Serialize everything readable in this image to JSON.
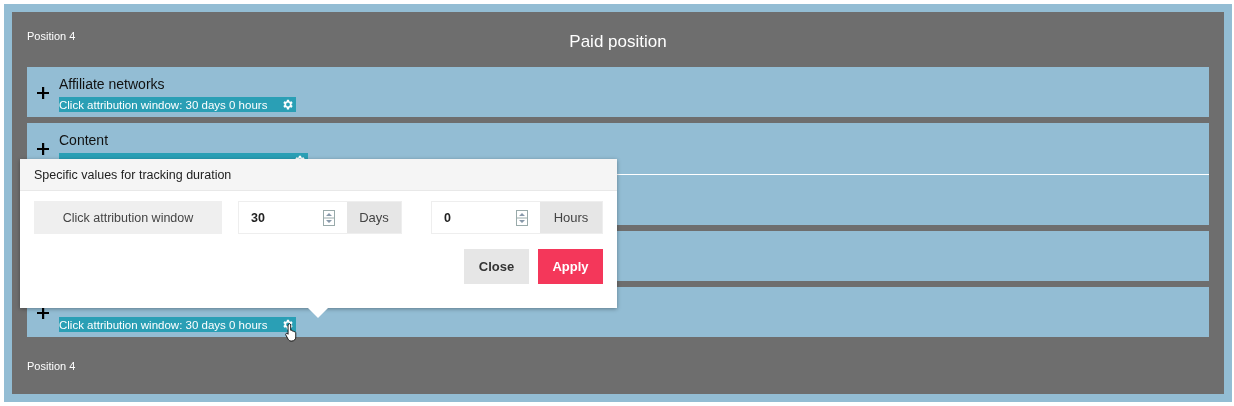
{
  "panel": {
    "label_top": "Position 4",
    "title": "Paid position",
    "label_bottom": "Position 4"
  },
  "rows": [
    {
      "kind": "channel",
      "name": "Affiliate networks",
      "caption": "Click attribution window: 30 days 0 hours",
      "drop_line_below": false
    },
    {
      "kind": "name_only",
      "name": "Content",
      "drop_line_below": true
    },
    {
      "kind": "covered",
      "drop_line_below": false
    },
    {
      "kind": "covered",
      "drop_line_below": false
    },
    {
      "kind": "caption_only",
      "caption": "Click attribution window: 30 days 0 hours",
      "drop_line_below": false,
      "hovered": true
    }
  ],
  "popup": {
    "title": "Specific values for tracking duration",
    "label": "Click attribution window",
    "days": {
      "value": "30",
      "unit": "Days"
    },
    "hours": {
      "value": "0",
      "unit": "Hours"
    },
    "buttons": [
      {
        "label": "Close",
        "kind": "secondary"
      },
      {
        "label": "Apply",
        "kind": "primary"
      }
    ]
  }
}
